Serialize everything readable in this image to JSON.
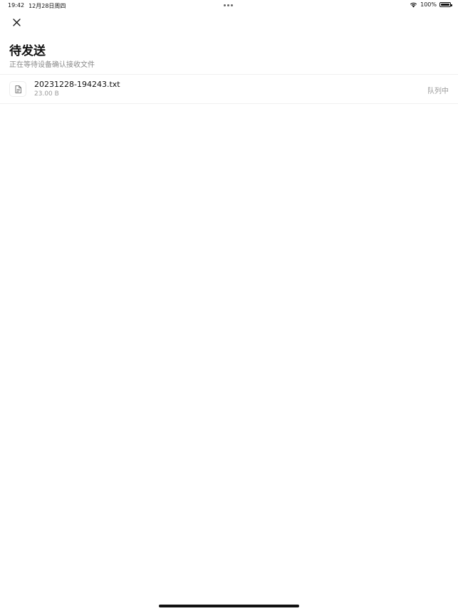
{
  "status_bar": {
    "time": "19:42",
    "date": "12月28日周四",
    "battery": "100%"
  },
  "header": {
    "close_icon": "close-icon",
    "title": "待发送",
    "subtitle": "正在等待设备确认接收文件"
  },
  "files": [
    {
      "icon": "document-icon",
      "name": "20231228-194243.txt",
      "size": "23.00 B",
      "status": "队列中"
    }
  ]
}
